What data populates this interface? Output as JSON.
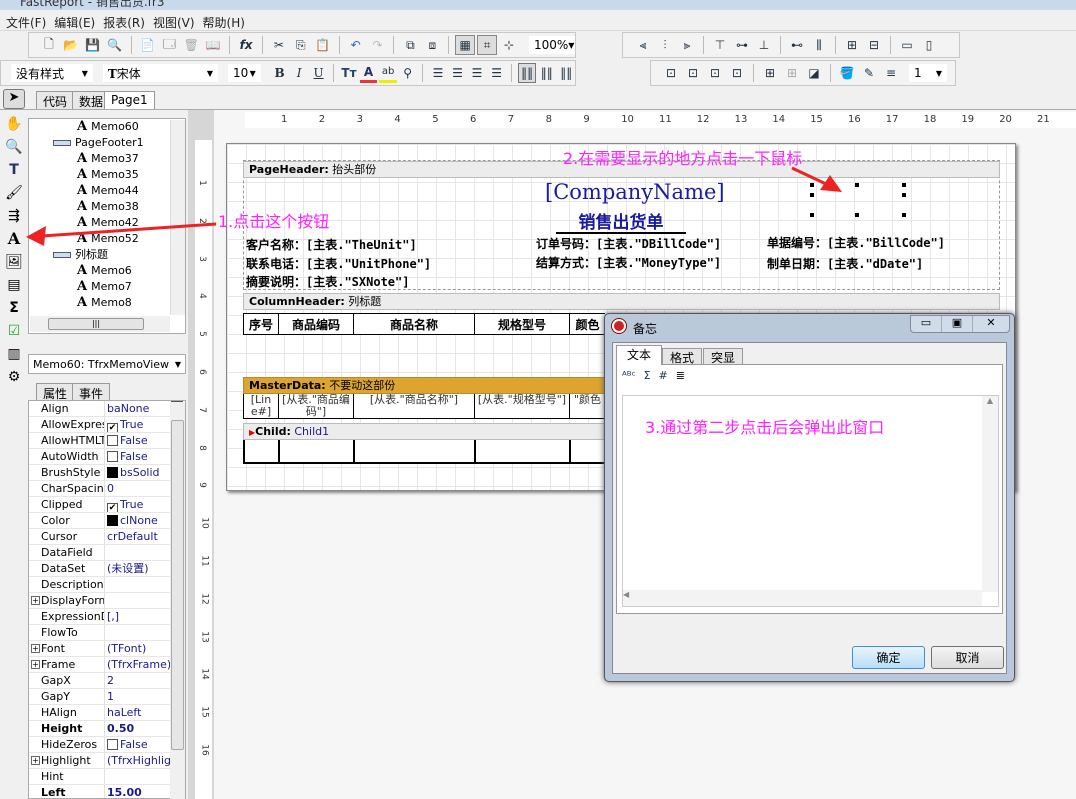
{
  "window": {
    "title": "FastReport - 销售出货.fr3"
  },
  "menu": [
    "文件(F)",
    "编辑(E)",
    "报表(R)",
    "视图(V)",
    "帮助(H)"
  ],
  "toolbar": {
    "zoom": "100%",
    "style": "没有样式",
    "font": "宋体",
    "font_size": "10",
    "bold": "B",
    "italic": "I",
    "underline": "U",
    "frame_width": "1"
  },
  "doc_tabs": [
    "代码",
    "数据",
    "Page1"
  ],
  "tree": {
    "items": [
      {
        "label": "Memo60",
        "level": 2,
        "type": "memo"
      },
      {
        "label": "PageFooter1",
        "level": 1,
        "type": "band"
      },
      {
        "label": "Memo37",
        "level": 2,
        "type": "memo"
      },
      {
        "label": "Memo35",
        "level": 2,
        "type": "memo"
      },
      {
        "label": "Memo44",
        "level": 2,
        "type": "memo"
      },
      {
        "label": "Memo38",
        "level": 2,
        "type": "memo"
      },
      {
        "label": "Memo42",
        "level": 2,
        "type": "memo"
      },
      {
        "label": "Memo52",
        "level": 2,
        "type": "memo"
      },
      {
        "label": "列标题",
        "level": 1,
        "type": "band"
      },
      {
        "label": "Memo6",
        "level": 2,
        "type": "memo"
      },
      {
        "label": "Memo7",
        "level": 2,
        "type": "memo"
      },
      {
        "label": "Memo8",
        "level": 2,
        "type": "memo"
      }
    ]
  },
  "inspector": {
    "object": "Memo60: TfrxMemoView",
    "tabs": [
      "属性",
      "事件"
    ],
    "rows": [
      {
        "k": "Align",
        "v": "baNone",
        "dropdown": true
      },
      {
        "k": "AllowExpress",
        "v": "True",
        "check": true
      },
      {
        "k": "AllowHTMLTa",
        "v": "False",
        "check": false
      },
      {
        "k": "AutoWidth",
        "v": "False",
        "check": false
      },
      {
        "k": "BrushStyle",
        "v": "bsSolid",
        "swatch": true
      },
      {
        "k": "CharSpacing",
        "v": "0"
      },
      {
        "k": "Clipped",
        "v": "True",
        "check": true
      },
      {
        "k": "Color",
        "v": "clNone",
        "swatch": true
      },
      {
        "k": "Cursor",
        "v": "crDefault"
      },
      {
        "k": "DataField",
        "v": ""
      },
      {
        "k": "DataSet",
        "v": "(未设置)"
      },
      {
        "k": "Description",
        "v": ""
      },
      {
        "k": "DisplayForma",
        "v": "",
        "expand": true
      },
      {
        "k": "ExpressionDe",
        "v": "[,]"
      },
      {
        "k": "FlowTo",
        "v": ""
      },
      {
        "k": "Font",
        "v": "(TFont)",
        "expand": true
      },
      {
        "k": "Frame",
        "v": "(TfrxFrame)",
        "expand": true
      },
      {
        "k": "GapX",
        "v": "2"
      },
      {
        "k": "GapY",
        "v": "1"
      },
      {
        "k": "HAlign",
        "v": "haLeft"
      },
      {
        "k": "Height",
        "v": "0.50",
        "bold": true
      },
      {
        "k": "HideZeros",
        "v": "False",
        "check": false
      },
      {
        "k": "Highlight",
        "v": "(TfrxHighlight",
        "expand": true
      },
      {
        "k": "Hint",
        "v": ""
      },
      {
        "k": "Left",
        "v": "15.00",
        "bold": true
      }
    ]
  },
  "ruler": {
    "h": [
      "1",
      "2",
      "3",
      "4",
      "5",
      "6",
      "7",
      "8",
      "9",
      "10",
      "11",
      "12",
      "13",
      "14",
      "15",
      "16",
      "17",
      "18",
      "19",
      "20",
      "21"
    ],
    "v": [
      "1",
      "2",
      "3",
      "4",
      "5",
      "6",
      "7",
      "8",
      "9",
      "10",
      "11",
      "12",
      "13",
      "14",
      "15",
      "16"
    ]
  },
  "report": {
    "page_header": {
      "type": "PageHeader:",
      "name": "抬头部份"
    },
    "company": "[CompanyName]",
    "title": "销售出货单",
    "fields": [
      "客户名称：[主表.\"TheUnit\"]",
      "联系电话：[主表.\"UnitPhone\"]",
      "摘要说明：[主表.\"SXNote\"]",
      "订单号码：[主表.\"DBillCode\"]",
      "结算方式：[主表.\"MoneyType\"]",
      "单据编号：[主表.\"BillCode\"]",
      "制单日期：[主表.\"dDate\"]"
    ],
    "column_header": {
      "type": "ColumnHeader:",
      "name": "列标题"
    },
    "columns": [
      "序号",
      "商品编码",
      "商品名称",
      "规格型号",
      "颜色"
    ],
    "master": {
      "type": "MasterData:",
      "name": "不要动这部份",
      "color": "#dda52f"
    },
    "master_cells": [
      "[Lin e#]",
      "[从表.\"商品编码\"]",
      "[从表.\"商品名称\"]",
      "[从表.\"规格型号\"]",
      "\"颜色"
    ],
    "child": {
      "type": "Child:",
      "name": "Child1"
    }
  },
  "annotations": {
    "step1": "1.点击这个按钮",
    "step2": "2.在需要显示的地方点击一下鼠标",
    "step3": "3.通过第二步点击后会弹出此窗口",
    "color": "#ff22ff",
    "arrow_color": "#ee2222"
  },
  "dialog": {
    "title": "备忘",
    "tabs": [
      "文本",
      "格式",
      "突显"
    ],
    "ok": "确定",
    "cancel": "取消"
  }
}
